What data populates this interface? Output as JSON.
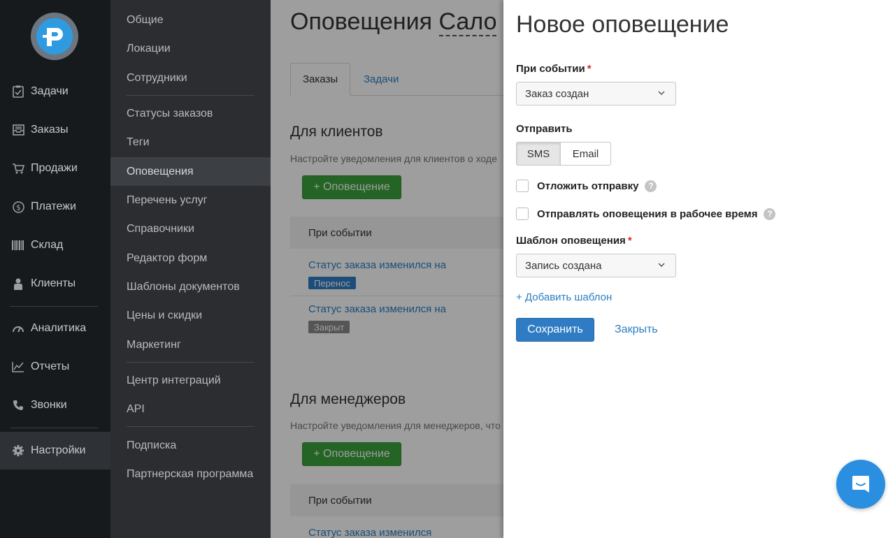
{
  "sidebar": {
    "items": [
      {
        "label": "Задачи",
        "icon": "clipboard-check-icon"
      },
      {
        "label": "Заказы",
        "icon": "inbox-icon"
      },
      {
        "label": "Продажи",
        "icon": "cart-icon"
      },
      {
        "label": "Платежи",
        "icon": "dollar-icon"
      },
      {
        "label": "Склад",
        "icon": "barcode-icon"
      },
      {
        "label": "Клиенты",
        "icon": "user-icon"
      },
      {
        "label": "Аналитика",
        "icon": "gauge-icon"
      },
      {
        "label": "Отчеты",
        "icon": "line-chart-icon"
      },
      {
        "label": "Звонки",
        "icon": "phone-icon"
      },
      {
        "label": "Настройки",
        "icon": "gear-icon"
      }
    ]
  },
  "submenu": {
    "items": [
      "Общие",
      "Локации",
      "Сотрудники",
      "Статусы заказов",
      "Теги",
      "Оповещения",
      "Перечень услуг",
      "Справочники",
      "Редактор форм",
      "Шаблоны документов",
      "Цены и скидки",
      "Маркетинг",
      "Центр интеграций",
      "API",
      "Подписка",
      "Партнерская программа"
    ],
    "active": "Оповещения"
  },
  "main": {
    "title_prefix": "Оповещения",
    "title_location": "Сало",
    "tabs": [
      "Заказы",
      "Задачи"
    ],
    "clients": {
      "title": "Для клиентов",
      "description": "Настройте уведомления для клиентов о ходе",
      "add_button": "+ Оповещение",
      "table_header": "При событии",
      "rows": [
        {
          "event": "Статус заказа изменился на",
          "badge": "Перенос",
          "badge_color": "#2f7cc4"
        },
        {
          "event": "Статус заказа изменился на",
          "badge": "Закрыт",
          "badge_color": "#8a8a8a"
        }
      ]
    },
    "managers": {
      "title": "Для менеджеров",
      "description": "Настройте уведомления для менеджеров, что",
      "add_button": "+ Оповещение",
      "table_header": "При событии",
      "rows": [
        {
          "event": "Статус заказа изменился"
        }
      ]
    }
  },
  "panel": {
    "title": "Новое оповещение",
    "event_label": "При событии",
    "event_value": "Заказ создан",
    "send_label": "Отправить",
    "send_options": [
      "SMS",
      "Email"
    ],
    "send_selected": "SMS",
    "delay_label": "Отложить отправку",
    "delay_checked": false,
    "worktime_label": "Отправлять оповещения в рабочее время",
    "worktime_checked": false,
    "help_glyph": "?",
    "template_label": "Шаблон оповещения",
    "template_value": "Запись создана",
    "add_template": "+ Добавить шаблон",
    "save": "Сохранить",
    "close": "Закрыть"
  },
  "colors": {
    "accent": "#2f7cc4",
    "green": "#3aa23a",
    "required": "#e0231c",
    "chat": "#2a8fe0"
  }
}
